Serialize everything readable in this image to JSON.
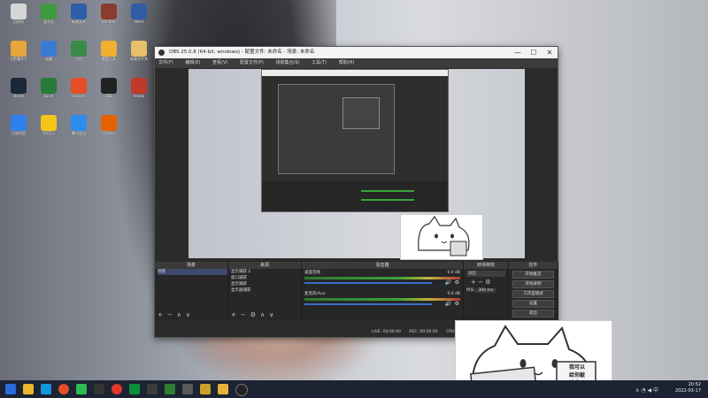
{
  "desktop": {
    "icons": [
      {
        "label": "回收站",
        "color": "#d6d6d6"
      },
      {
        "label": "爱奇艺",
        "color": "#3c9b3c"
      },
      {
        "label": "新建文本",
        "color": "#2e5ea8"
      },
      {
        "label": "WinRAR",
        "color": "#8b3c2f"
      },
      {
        "label": "Word",
        "color": "#2f5da6"
      },
      {
        "label": "光影魔术手",
        "color": "#e8a53c"
      },
      {
        "label": "收藏",
        "color": "#3a7bd5"
      },
      {
        "label": "文档",
        "color": "#3a8b4a"
      },
      {
        "label": "截图工具",
        "color": "#f0b030"
      },
      {
        "label": "新建文件夹",
        "color": "#e8c06a"
      },
      {
        "label": "Steam",
        "color": "#1b2838"
      },
      {
        "label": "Excel",
        "color": "#2a7a3a"
      },
      {
        "label": "Chrome",
        "color": "#e44d26"
      },
      {
        "label": "OBS",
        "color": "#222"
      },
      {
        "label": "Adobe",
        "color": "#c0392b"
      },
      {
        "label": "百度网盘",
        "color": "#2f80ed"
      },
      {
        "label": "QQ音乐",
        "color": "#f5c518"
      },
      {
        "label": "腾讯会议",
        "color": "#2d8cf0"
      },
      {
        "label": "Firefox",
        "color": "#e66000"
      }
    ]
  },
  "obs": {
    "title": "OBS 25.0.8 (64-bit, windows) - 配置文件: 未命名 - 场景: 未命名",
    "menu": [
      "文件(F)",
      "编辑(E)",
      "查看(V)",
      "配置文件(P)",
      "场景集合(S)",
      "工具(T)",
      "帮助(H)"
    ],
    "window_buttons": {
      "minimize": "—",
      "maximize": "☐",
      "close": "✕"
    },
    "panels": {
      "scenes": {
        "title": "场景",
        "items": [
          "场景"
        ]
      },
      "sources": {
        "title": "来源",
        "items": [
          "显示捕获 2",
          "窗口捕获",
          "显示捕获",
          "显示器捕获"
        ]
      },
      "mixer": {
        "title": "混音器",
        "channels": [
          {
            "name": "桌面音频",
            "db": "0.0 dB"
          },
          {
            "name": "麦克风/Aux",
            "db": "0.0 dB"
          }
        ]
      },
      "transitions": {
        "title": "转场特效",
        "selected": "淡出",
        "duration_label": "时长",
        "duration_value": "300 ms"
      },
      "controls": {
        "title": "控件",
        "buttons": [
          "开始推流",
          "开始录制",
          "工作室模式",
          "设置",
          "退出"
        ]
      }
    },
    "status": {
      "live": "LIVE: 00:00:00",
      "rec": "REC: 00:00:00",
      "cpu": "CPU: 0.4%, 30.00 fps"
    }
  },
  "sticker": {
    "keyboard_text": "我可以\n给你敲\n键盘吗"
  },
  "taskbar": {
    "time": "20:52",
    "date": "2022-03-17",
    "lang": "中"
  },
  "colors": {
    "taskbar": "#1c2333",
    "obs_bg": "#2b2b2b",
    "meter_green": "#3aa13a",
    "fader_blue": "#3a6ec8"
  }
}
